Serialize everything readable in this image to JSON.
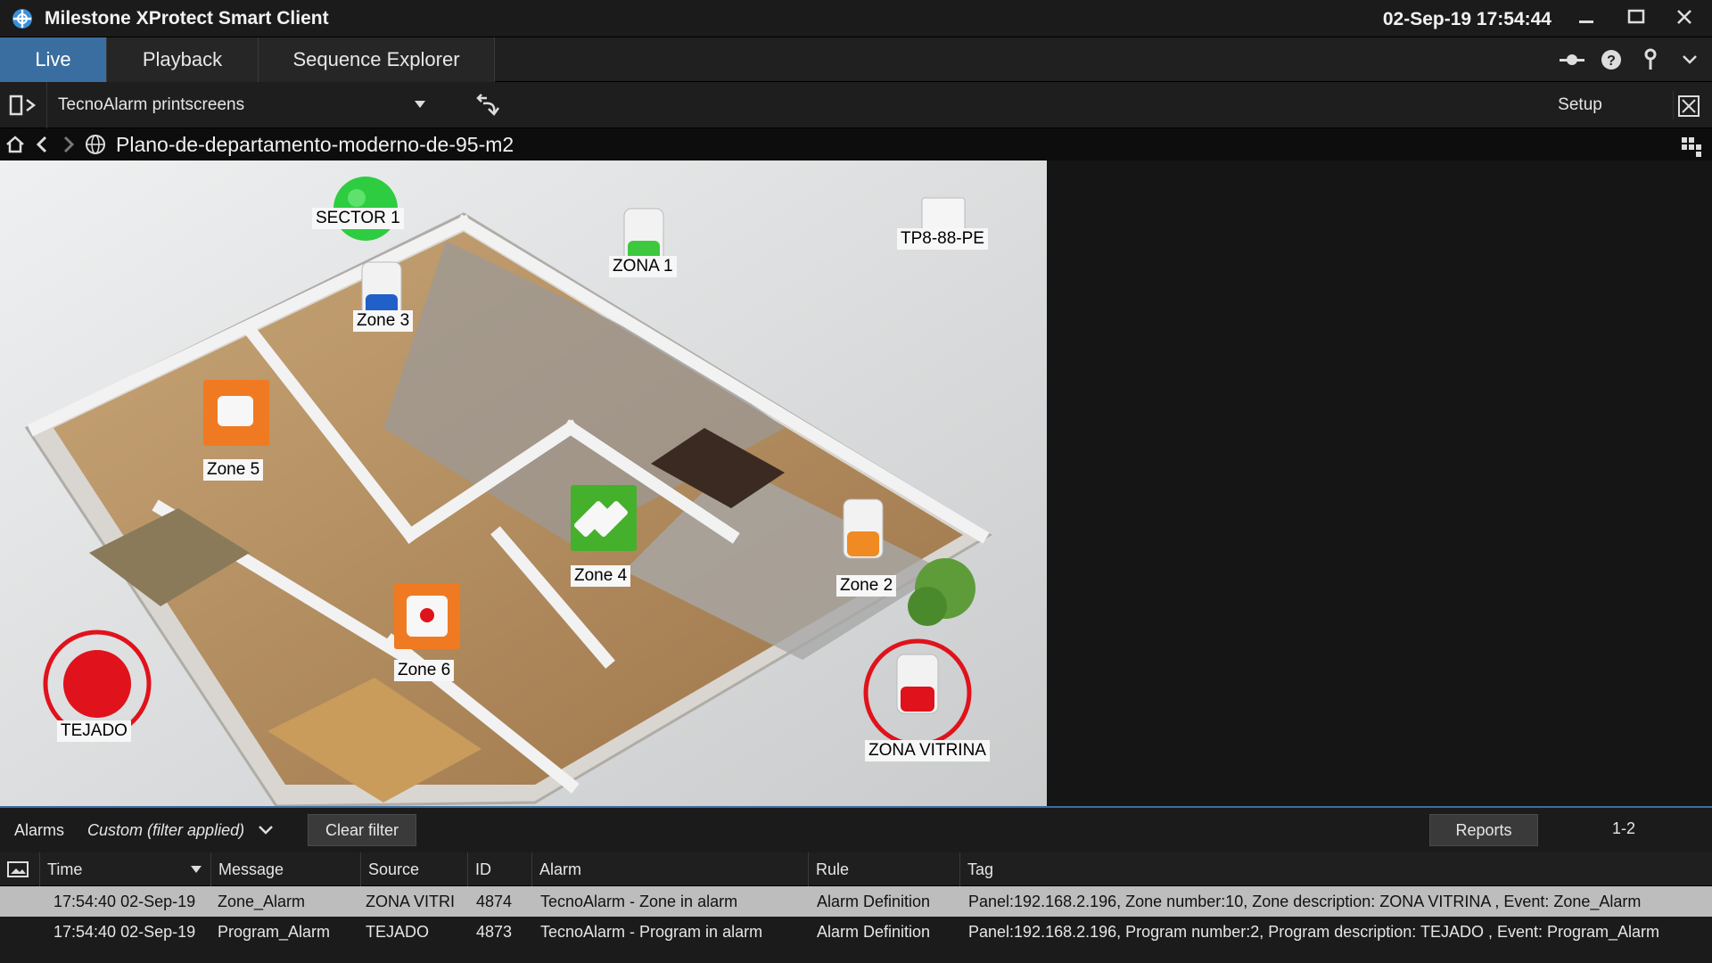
{
  "app": {
    "title": "Milestone XProtect Smart Client",
    "clock": "02-Sep-19 17:54:44"
  },
  "tabs": [
    {
      "label": "Live",
      "active": true
    },
    {
      "label": "Playback",
      "active": false
    },
    {
      "label": "Sequence Explorer",
      "active": false
    }
  ],
  "toolbar_icons": [
    "status-icon",
    "help-icon",
    "login-icon",
    "menu-chevron-icon"
  ],
  "view": {
    "selected": "TecnoAlarm printscreens",
    "setup_label": "Setup"
  },
  "map": {
    "name": "Plano-de-departamento-moderno-de-95-m2",
    "markers": [
      {
        "label": "SECTOR 1",
        "kind": "green-circle"
      },
      {
        "label": "ZONA 1",
        "kind": "detector-green"
      },
      {
        "label": "TP8-88-PE",
        "kind": "panel"
      },
      {
        "label": "Zone 3",
        "kind": "detector-blue"
      },
      {
        "label": "Zone 5",
        "kind": "orange-tile"
      },
      {
        "label": "Zone 4",
        "kind": "green-tile"
      },
      {
        "label": "Zone 2",
        "kind": "detector-orange"
      },
      {
        "label": "Zone 6",
        "kind": "orange-tile"
      },
      {
        "label": "TEJADO",
        "kind": "red-circle-alarm"
      },
      {
        "label": "ZONA VITRINA",
        "kind": "detector-red-alarm"
      }
    ]
  },
  "alarms": {
    "title": "Alarms",
    "filter": "Custom (filter applied)",
    "clear_filter": "Clear filter",
    "reports": "Reports",
    "range": "1-2",
    "columns": [
      "Time",
      "Message",
      "Source",
      "ID",
      "Alarm",
      "Rule",
      "Tag"
    ],
    "rows": [
      {
        "time": "17:54:40 02-Sep-19",
        "message": "Zone_Alarm",
        "source": "ZONA VITRI",
        "id": "4874",
        "alarm": "TecnoAlarm - Zone in alarm",
        "rule": "Alarm Definition",
        "tag": "Panel:192.168.2.196, Zone number:10, Zone description: ZONA VITRINA , Event: Zone_Alarm"
      },
      {
        "time": "17:54:40 02-Sep-19",
        "message": "Program_Alarm",
        "source": "TEJADO",
        "id": "4873",
        "alarm": "TecnoAlarm - Program in alarm",
        "rule": "Alarm Definition",
        "tag": "Panel:192.168.2.196, Program number:2, Program description: TEJADO , Event: Program_Alarm"
      }
    ]
  },
  "colors": {
    "accent": "#3b6ea0",
    "alarm_red": "#e0121b",
    "ok_green": "#2ecc40",
    "tile_orange": "#f07a22"
  }
}
